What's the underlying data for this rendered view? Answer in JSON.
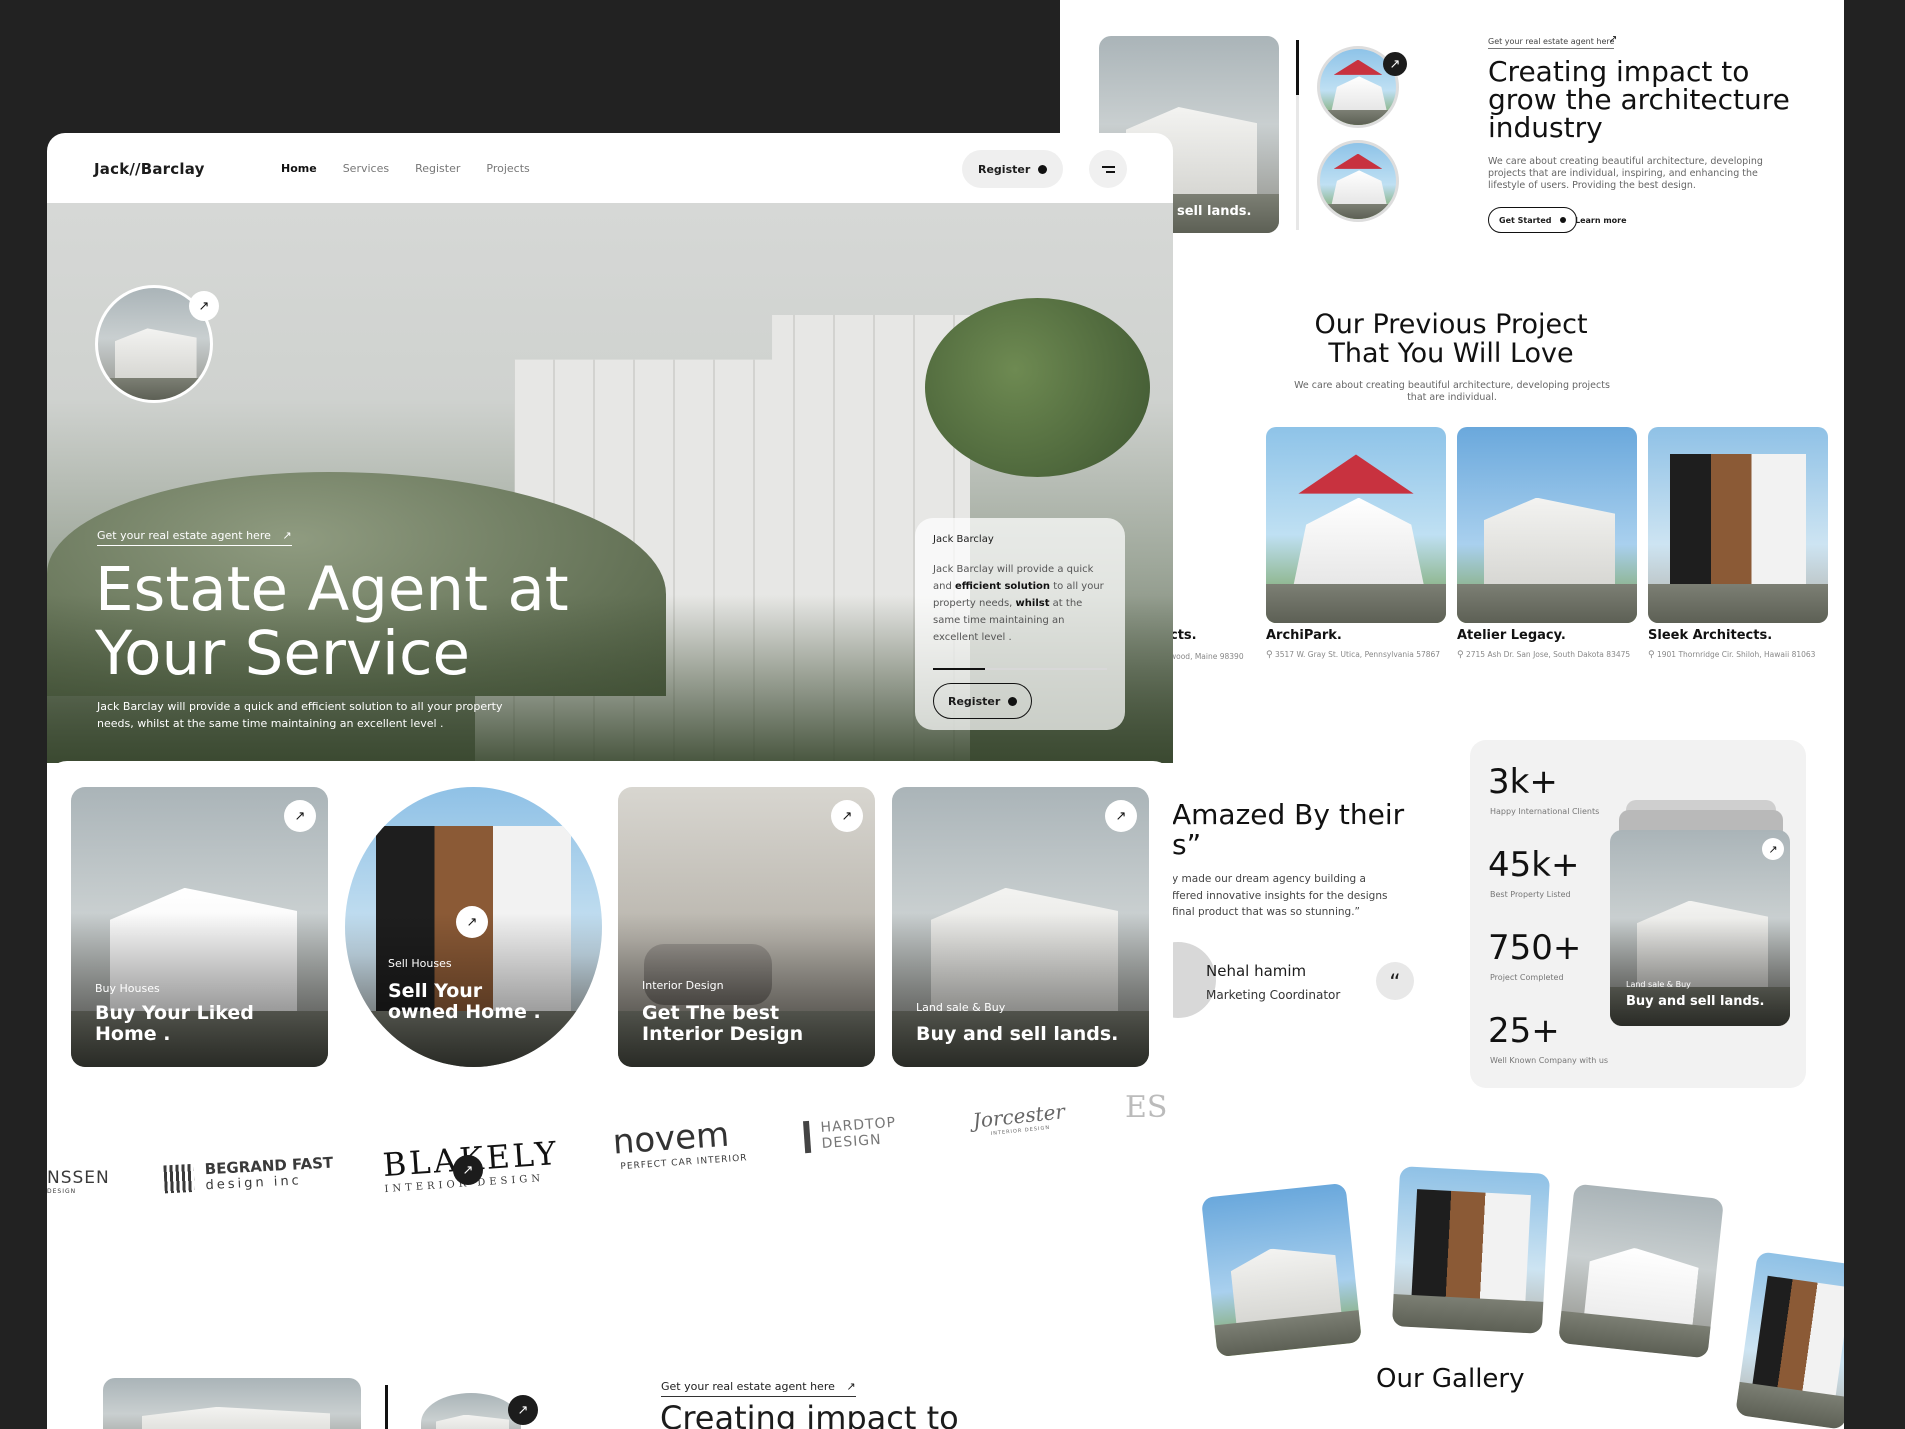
{
  "nav": {
    "logo": "Jack//Barclay",
    "items": [
      "Home",
      "Services",
      "Register",
      "Projects"
    ],
    "register_label": "Register"
  },
  "hero": {
    "eyebrow": "Get your real estate agent here",
    "title_line1": "Estate Agent at",
    "title_line2": "Your Service",
    "description": "Jack Barclay will provide a quick and efficient solution to all your property needs, whilst at the same time maintaining an excellent level .",
    "card": {
      "name": "Jack Barclay",
      "t1": "Jack Barclay will provide a quick and ",
      "b1": "efficient solution",
      "t2": " to all your property needs, ",
      "b2": "whilst",
      "t3": " at the same time maintaining an excellent level .",
      "button": "Register"
    }
  },
  "service_cards": [
    {
      "small": "Buy Houses",
      "big": "Buy Your Liked Home ."
    },
    {
      "small": "Sell Houses",
      "big": "Sell Your owned Home ."
    },
    {
      "small": "Interior Design",
      "big": "Get The best Interior Design"
    },
    {
      "small": "Land sale & Buy",
      "big": "Buy and sell lands."
    }
  ],
  "brands": {
    "b1": "NSSEN",
    "b1_sub": "DESIGN",
    "b2": "BEGRAND FAST",
    "b2_sub": "design inc",
    "b3": "BLAKELY",
    "b3_sub": "INTERIOR DESIGN",
    "b4": "novem",
    "b4_sub": "PERFECT CAR INTERIOR",
    "b5": "HARDTOP",
    "b5_sub": "DESIGN",
    "b6": "Jorcester",
    "b6_sub": "INTERIOR DESIGN",
    "b7": "ES"
  },
  "front_bottom": {
    "eyebrow": "Get your real estate agent here",
    "title": "Creating impact to"
  },
  "impact": {
    "eyebrow": "Get your real estate agent here",
    "title_line1": "Creating impact to",
    "title_line2": "grow the architecture",
    "title_line3": "industry",
    "description": "We care about creating beautiful architecture, developing projects that are individual, inspiring, and enhancing the lifestyle of users. Providing the best design.",
    "primary_button": "Get Started",
    "secondary_link": "Learn more",
    "image_caption": "sell lands."
  },
  "projects": {
    "title_line1": "Our Previous Project",
    "title_line2": "That You Will Love",
    "description": "We care about creating beautiful architecture, developing projects that are individual.",
    "items": [
      {
        "name": "cts.",
        "address": "wood, Maine 98390"
      },
      {
        "name": "ArchiPark.",
        "address": "3517 W. Gray St. Utica, Pennsylvania 57867"
      },
      {
        "name": "Atelier Legacy.",
        "address": "2715 Ash Dr. San Jose, South Dakota 83475"
      },
      {
        "name": "Sleek Architects.",
        "address": "1901 Thornridge Cir. Shiloh, Hawaii 81063"
      }
    ]
  },
  "testimonial": {
    "title_line1": "Amazed By their",
    "title_line2": "s”",
    "quote_line1": "y made our dream agency building a",
    "quote_line2": "ffered innovative insights for the designs",
    "quote_line3": "final product that was so stunning.”",
    "author": "Nehal hamim",
    "role": "Marketing Coordinator",
    "quote_glyph": "“"
  },
  "stats": [
    {
      "value": "3k+",
      "label": "Happy International Clients"
    },
    {
      "value": "45k+",
      "label": "Best Property Listed"
    },
    {
      "value": "750+",
      "label": "Project Completed"
    },
    {
      "value": "25+",
      "label": "Well Known Company with us"
    }
  ],
  "stats_card": {
    "small": "Land sale & Buy",
    "big": "Buy and sell lands."
  },
  "gallery": {
    "title": "Our Gallery"
  },
  "icons": {
    "arrow": "↗"
  }
}
